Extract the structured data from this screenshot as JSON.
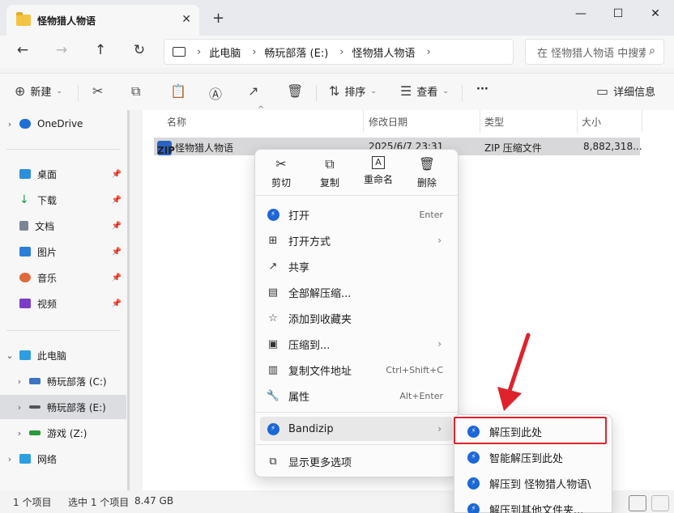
{
  "window": {
    "tab_title": "怪物猎人物语",
    "new_tab": "+",
    "close_tab": "✕",
    "minimize": "—",
    "maximize": "☐",
    "close": "✕"
  },
  "nav": {
    "back": "←",
    "forward": "→",
    "up": "↑",
    "refresh": "↻",
    "breadcrumb": [
      "此电脑",
      "畅玩部落 (E:)",
      "怪物猎人物语"
    ],
    "sep": "›",
    "search_placeholder": "在 怪物猎人物语 中搜索"
  },
  "toolbar": {
    "new_label": "新建",
    "sort_label": "排序",
    "view_label": "查看",
    "more": "···",
    "details_label": "详细信息"
  },
  "sidebar": {
    "onedrive": "OneDrive",
    "quick": [
      {
        "label": "桌面",
        "color": "#2d8fd9"
      },
      {
        "label": "下载",
        "color": "#1a9b4d"
      },
      {
        "label": "文档",
        "color": "#7a8595"
      },
      {
        "label": "图片",
        "color": "#2c7fd8"
      },
      {
        "label": "音乐",
        "color": "#e06a3a"
      },
      {
        "label": "视频",
        "color": "#7d3cc7"
      }
    ],
    "this_pc": "此电脑",
    "drives": [
      {
        "label": "畅玩部落 (C:)"
      },
      {
        "label": "畅玩部落 (E:)"
      },
      {
        "label": "游戏 (Z:)"
      }
    ],
    "network": "网络"
  },
  "columns": {
    "name": "名称",
    "modified": "修改日期",
    "type": "类型",
    "size": "大小"
  },
  "file": {
    "name": "怪物猎人物语",
    "modified": "2025/6/7 23:31",
    "type": "ZIP 压缩文件",
    "size": "8,882,318..."
  },
  "context_menu": {
    "quick": [
      {
        "label": "剪切",
        "icon": "✂"
      },
      {
        "label": "复制",
        "icon": "⧉"
      },
      {
        "label": "重命名",
        "icon": "A"
      },
      {
        "label": "删除",
        "icon": "🗑"
      }
    ],
    "items": [
      {
        "label": "打开",
        "shortcut": "Enter"
      },
      {
        "label": "打开方式",
        "shortcut": "›"
      },
      {
        "label": "共享",
        "shortcut": ""
      },
      {
        "label": "全部解压缩...",
        "shortcut": ""
      },
      {
        "label": "添加到收藏夹",
        "shortcut": ""
      },
      {
        "label": "压缩到...",
        "shortcut": "›"
      },
      {
        "label": "复制文件地址",
        "shortcut": "Ctrl+Shift+C"
      },
      {
        "label": "属性",
        "shortcut": "Alt+Enter"
      },
      {
        "label": "Bandizip",
        "shortcut": "›"
      },
      {
        "label": "显示更多选项",
        "shortcut": ""
      }
    ]
  },
  "submenu": {
    "items": [
      "解压到此处",
      "智能解压到此处",
      "解压到 怪物猎人物语\\",
      "解压到其他文件夹..."
    ]
  },
  "status": {
    "count": "1 个项目",
    "selected": "选中 1 个项目",
    "size": "8.47 GB"
  },
  "accent_color": "#e0222c"
}
